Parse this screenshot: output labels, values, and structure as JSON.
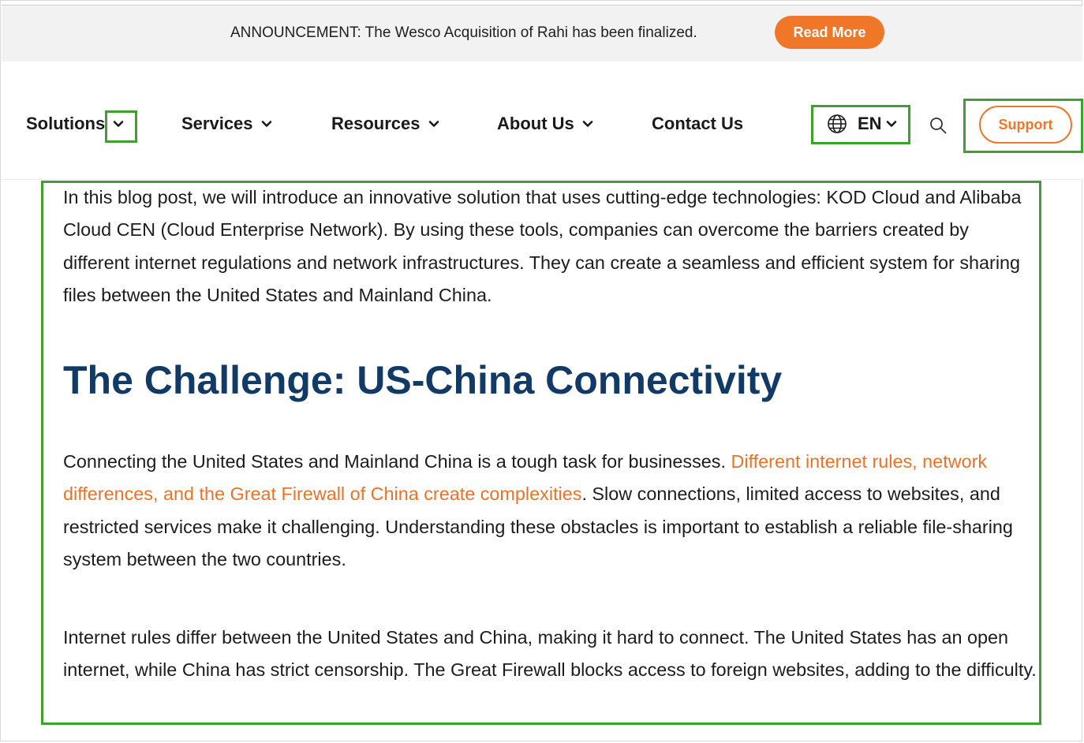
{
  "announcement": {
    "text": "ANNOUNCEMENT: The Wesco Acquisition of Rahi has been finalized.",
    "button_label": "Read More"
  },
  "nav": {
    "items": [
      {
        "label": "Solutions",
        "has_dropdown": true
      },
      {
        "label": "Services",
        "has_dropdown": true
      },
      {
        "label": "Resources",
        "has_dropdown": true
      },
      {
        "label": "About Us",
        "has_dropdown": true
      },
      {
        "label": "Contact Us",
        "has_dropdown": false
      }
    ],
    "language": "EN",
    "support_label": "Support"
  },
  "article": {
    "intro": "In this blog post, we will introduce an innovative solution that uses cutting-edge technologies: KOD Cloud and Alibaba Cloud CEN (Cloud Enterprise Network). By using these tools, companies can overcome the barriers created by different internet regulations and network infrastructures. They can create a seamless and efficient system for sharing files between the United States and Mainland China.",
    "heading": "The Challenge: US-China Connectivity",
    "p2_before": "Connecting the United States and Mainland China is a tough task for businesses. ",
    "p2_link": "Different internet rules, network differences, and the Great Firewall of China create complexities",
    "p2_after": ". Slow connections, limited access to websites, and restricted services make it challenging. Understanding these obstacles is important to establish a reliable file-sharing system between the two countries.",
    "p3": "Internet rules differ between the United States and China, making it hard to connect. The United States has an open internet, while China has strict censorship. The Great Firewall blocks access to foreign websites, adding to the difficulty."
  },
  "colors": {
    "accent": "#f07628",
    "heading": "#123a67",
    "highlight_box": "#3aa32a",
    "announcement_bg": "#f2f2f2"
  },
  "icons": [
    "chevron-down-icon",
    "globe-icon",
    "search-icon"
  ]
}
